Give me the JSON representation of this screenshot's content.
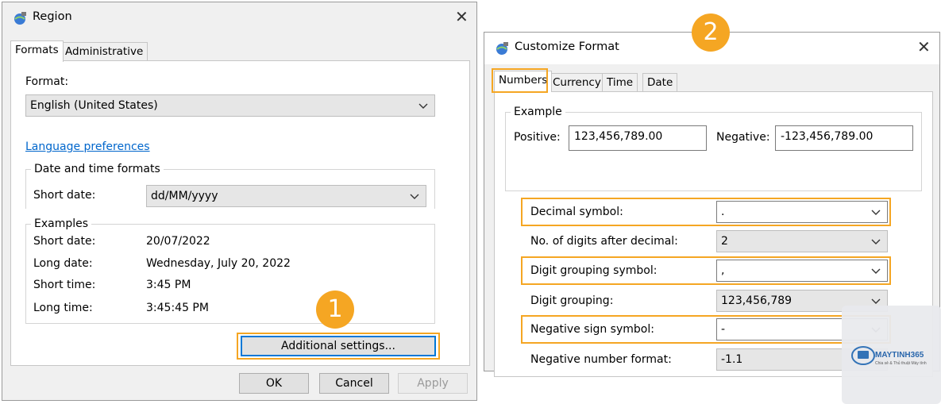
{
  "region": {
    "title": "Region",
    "tabs": [
      "Formats",
      "Administrative"
    ],
    "format_label": "Format:",
    "format_value": "English (United States)",
    "language_link": "Language preferences",
    "date_time_group": "Date and time formats",
    "short_date_label": "Short date:",
    "short_date_value": "dd/MM/yyyy",
    "examples_group": "Examples",
    "examples": [
      {
        "label": "Short date:",
        "value": "20/07/2022"
      },
      {
        "label": "Long date:",
        "value": "Wednesday, July 20, 2022"
      },
      {
        "label": "Short time:",
        "value": "3:45 PM"
      },
      {
        "label": "Long time:",
        "value": "3:45:45 PM"
      }
    ],
    "additional_settings": "Additional settings...",
    "ok": "OK",
    "cancel": "Cancel",
    "apply": "Apply"
  },
  "customize": {
    "title": "Customize Format",
    "tabs": [
      "Numbers",
      "Currency",
      "Time",
      "Date"
    ],
    "example_group": "Example",
    "positive_label": "Positive:",
    "positive_value": "123,456,789.00",
    "negative_label": "Negative:",
    "negative_value": "-123,456,789.00",
    "settings": [
      {
        "label": "Decimal symbol:",
        "value": "."
      },
      {
        "label": "No. of digits after decimal:",
        "value": "2"
      },
      {
        "label": "Digit grouping symbol:",
        "value": ","
      },
      {
        "label": "Digit grouping:",
        "value": "123,456,789"
      },
      {
        "label": "Negative sign symbol:",
        "value": "-"
      },
      {
        "label": "Negative number format:",
        "value": "-1.1"
      }
    ]
  },
  "badges": [
    "1",
    "2"
  ],
  "watermark": {
    "brand": "MAYTINH365",
    "tagline": "Chia sẻ & Thủ thuật Máy tính"
  },
  "colors": {
    "accent": "#f5a623",
    "link": "#0066cc",
    "focus": "#0078d7"
  }
}
